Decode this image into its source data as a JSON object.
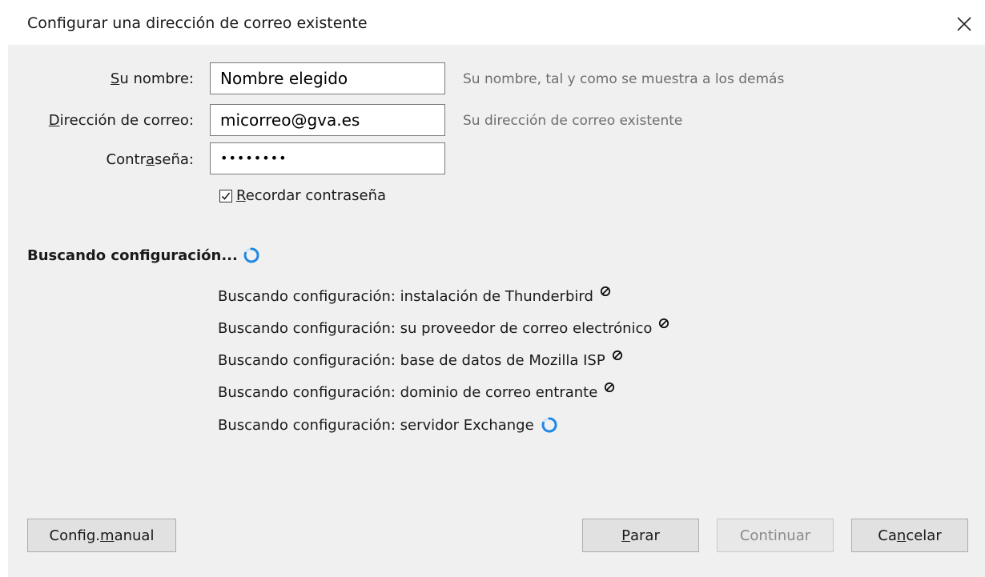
{
  "window": {
    "title": "Configurar una dirección de correo existente"
  },
  "form": {
    "name": {
      "label_pre": "",
      "label_key": "S",
      "label_post": "u nombre:",
      "value": "Nombre elegido",
      "hint": "Su nombre, tal y como se muestra a los demás"
    },
    "email": {
      "label_pre": "",
      "label_key": "D",
      "label_post": "irección de correo:",
      "value": "micorreo@gva.es",
      "hint": "Su dirección de correo existente"
    },
    "password": {
      "label_pre": "Contr",
      "label_key": "a",
      "label_post": "seña:",
      "value": "••••••••"
    },
    "remember": {
      "label_key": "R",
      "label_post": "ecordar contraseña",
      "checked": true
    }
  },
  "search": {
    "heading": "Buscando configuración...",
    "probes": [
      {
        "text": "Buscando configuración: instalación de Thunderbird",
        "status": "blocked-icon"
      },
      {
        "text": "Buscando configuración: su proveedor de correo electrónico",
        "status": "blocked-icon"
      },
      {
        "text": "Buscando configuración: base de datos de Mozilla ISP",
        "status": "blocked-icon"
      },
      {
        "text": "Buscando configuración: dominio de correo entrante",
        "status": "blocked-icon"
      },
      {
        "text": "Buscando configuración: servidor Exchange",
        "status": "spinner-icon"
      }
    ]
  },
  "buttons": {
    "manual": {
      "pre": "Config. ",
      "key": "m",
      "post": "anual"
    },
    "stop": {
      "pre": "",
      "key": "P",
      "post": "arar"
    },
    "continue": {
      "pre": "",
      "key": "",
      "post": "Continuar"
    },
    "cancel": {
      "pre": "Ca",
      "key": "n",
      "post": "celar"
    }
  },
  "colors": {
    "spinner": "#1e88e5",
    "panel": "#f0f0f0",
    "hint": "#6e6e6e"
  }
}
